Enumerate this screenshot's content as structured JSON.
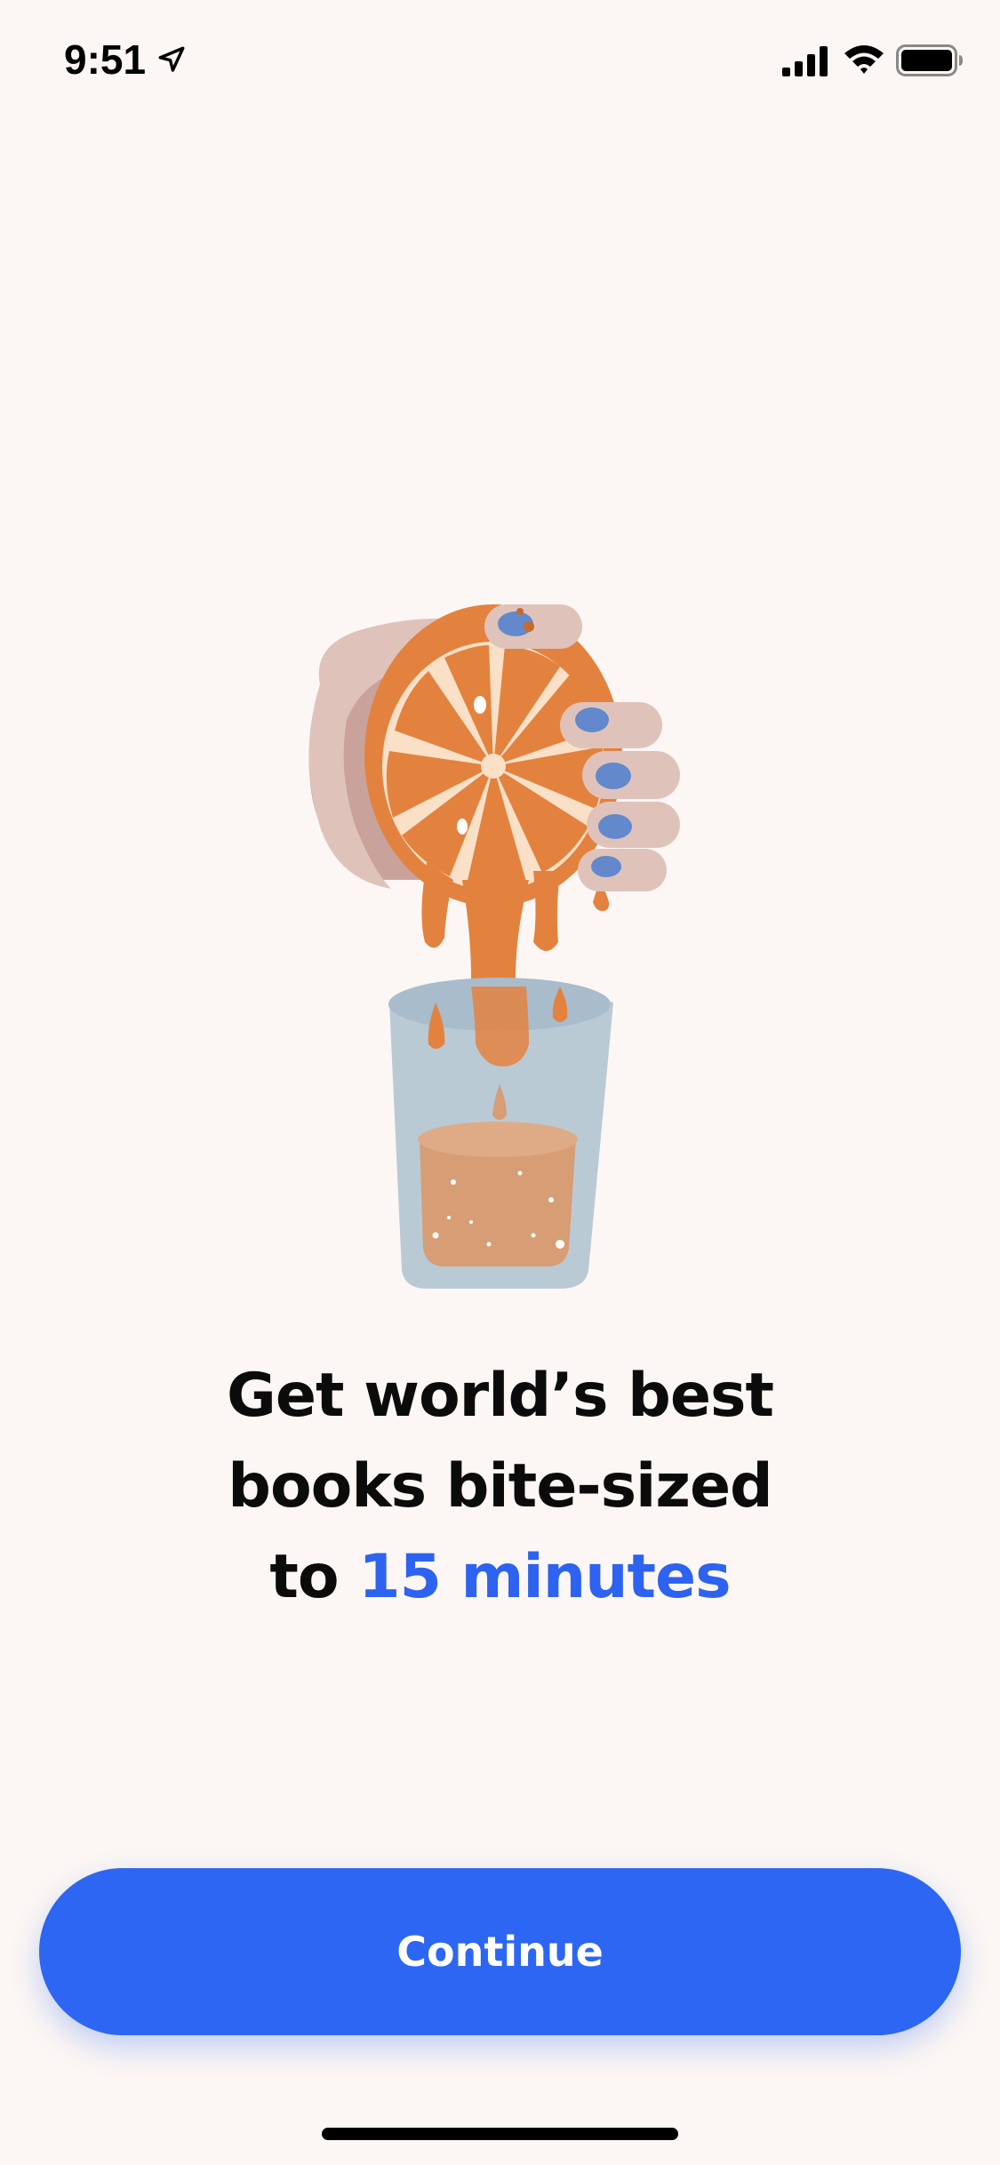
{
  "status_bar": {
    "time": "9:51",
    "icons": [
      "location-arrow-icon",
      "cellular-signal-icon",
      "wifi-icon",
      "battery-icon"
    ]
  },
  "illustration": {
    "name": "hand-squeezing-orange-into-glass",
    "colors": {
      "orange": "#e3823e",
      "orange_light": "#fbe0c8",
      "hand": "#dfc3bb",
      "hand_shadow": "#c9a29b",
      "nails": "#6388cc",
      "glass": "#b3c4d2",
      "juice_in_glass": "#d79d75"
    }
  },
  "headline": {
    "line1": "Get world’s best",
    "line2": "books bite-sized",
    "line3_prefix": "to ",
    "line3_accent": "15 minutes"
  },
  "continue_button": {
    "label": "Continue"
  },
  "colors": {
    "background": "#fcf7f4",
    "accent": "#2d63f0",
    "text": "#0b0b0b"
  }
}
